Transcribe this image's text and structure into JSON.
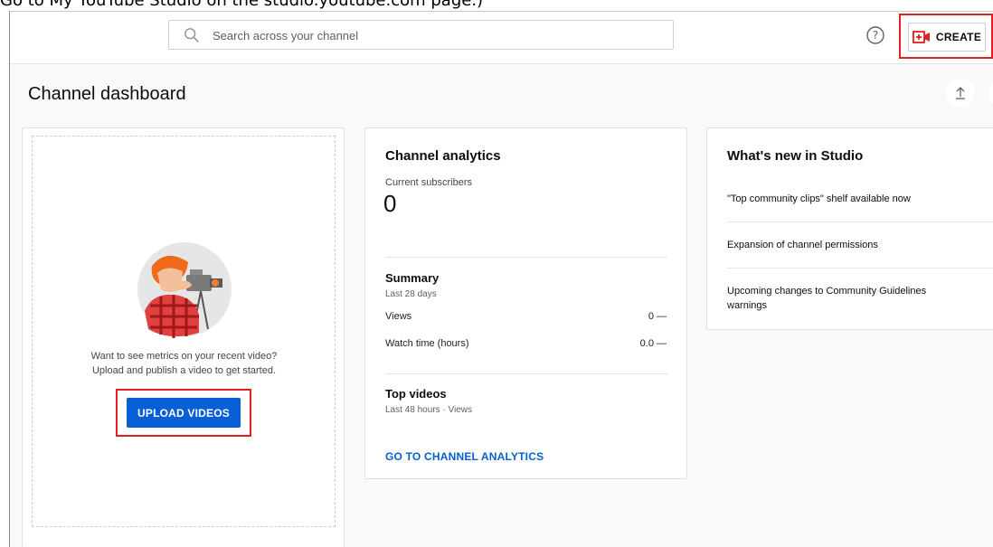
{
  "caption_partial": "Go to My YouTube Studio on the studio.youtube.com page.)",
  "header": {
    "search_placeholder": "Search across your channel",
    "create_label": "CREATE"
  },
  "page": {
    "title": "Channel dashboard"
  },
  "upload_card": {
    "prompt_line1": "Want to see metrics on your recent video?",
    "prompt_line2": "Upload and publish a video to get started.",
    "button_label": "UPLOAD VIDEOS"
  },
  "analytics_card": {
    "title": "Channel analytics",
    "subscribers_label": "Current subscribers",
    "subscribers_value": "0",
    "summary_title": "Summary",
    "summary_period": "Last 28 days",
    "rows": [
      {
        "label": "Views",
        "value": "0 —"
      },
      {
        "label": "Watch time (hours)",
        "value": "0.0 —"
      }
    ],
    "top_videos_title": "Top videos",
    "top_videos_period": "Last 48 hours · Views",
    "link_label": "GO TO CHANNEL ANALYTICS"
  },
  "news_card": {
    "title": "What's new in Studio",
    "items": [
      "\"Top community clips\" shelf available now",
      "Expansion of channel permissions",
      "Upcoming changes to Community Guidelines warnings"
    ]
  },
  "colors": {
    "accent_blue": "#065fd4",
    "highlight_red": "#e02020"
  },
  "icons": [
    "search-icon",
    "help-icon",
    "create-video-icon",
    "upload-arrow-icon"
  ]
}
